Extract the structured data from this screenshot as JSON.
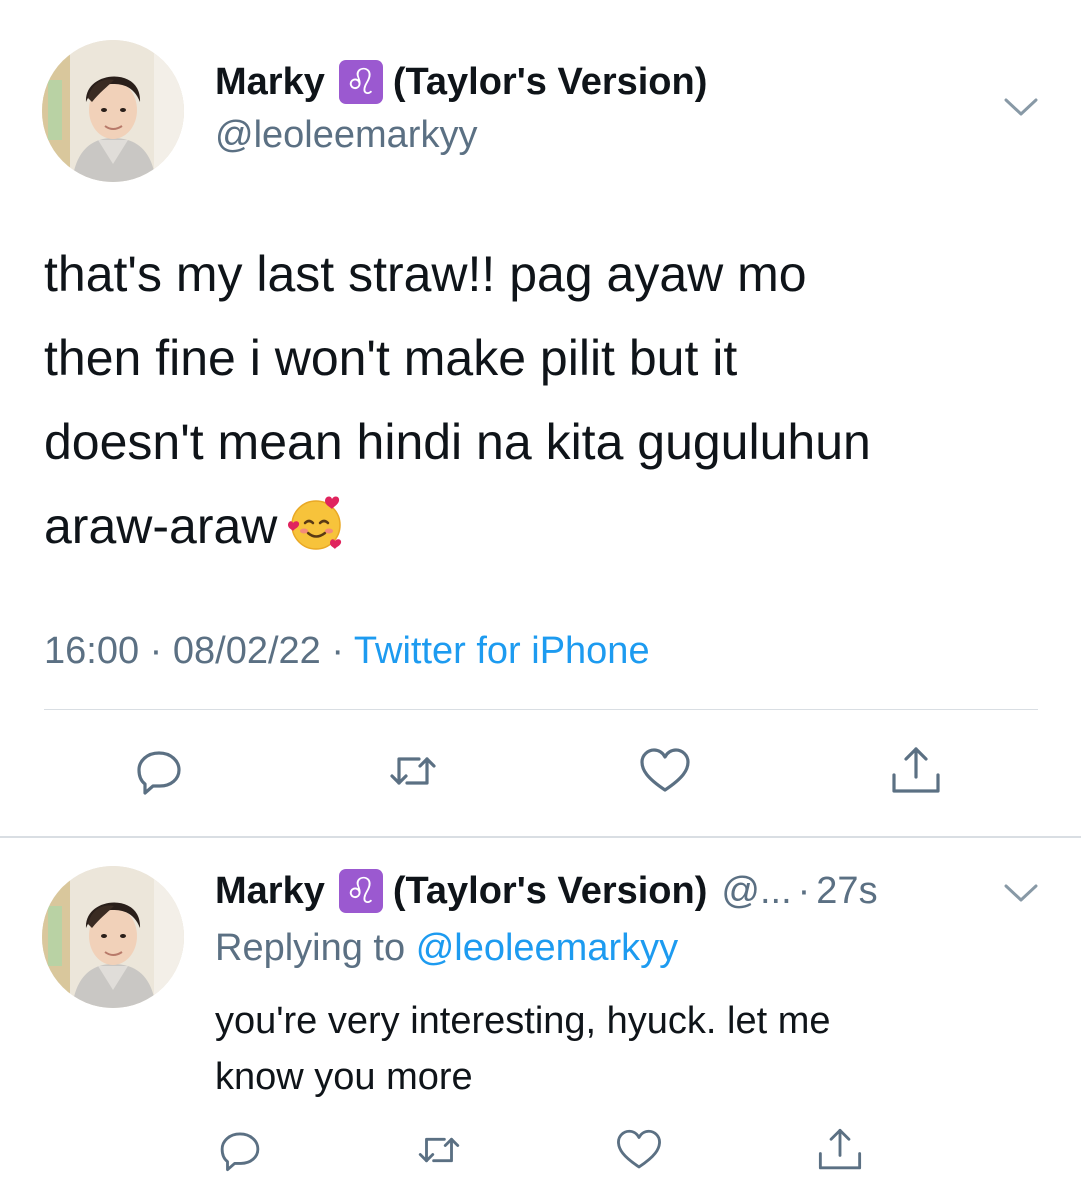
{
  "main_tweet": {
    "display_name": "Marky",
    "name_badge": "♌",
    "name_suffix": "(Taylor's Version)",
    "handle": "@leoleemarkyy",
    "text_lines": [
      "that's my last straw!! pag ayaw mo",
      "then fine i won't make pilit but it",
      "doesn't mean hindi na kita guguluhun",
      "araw-araw"
    ],
    "emoji": "smiling-face-with-hearts-emoji",
    "time": "16:00",
    "separator": "·",
    "date": "08/02/22",
    "source": "Twitter for iPhone",
    "actions": [
      "reply-icon",
      "retweet-icon",
      "like-icon",
      "share-icon"
    ]
  },
  "reply_tweet": {
    "display_name": "Marky",
    "name_badge": "♌",
    "name_suffix": "(Taylor's Version)",
    "handle": "@...",
    "separator": "·",
    "time": "27s",
    "replying_prefix": "Replying to",
    "replying_handle": "@leoleemarkyy",
    "text_lines": [
      "you're very interesting, hyuck. let me",
      "know you more"
    ],
    "actions": [
      "reply-icon",
      "retweet-icon",
      "like-icon",
      "share-icon"
    ]
  },
  "colors": {
    "text": "#0f1419",
    "secondary": "#5b7083",
    "link": "#1d9bf0",
    "leo_badge": "#9b59d0",
    "divider": "#d9dee3"
  }
}
